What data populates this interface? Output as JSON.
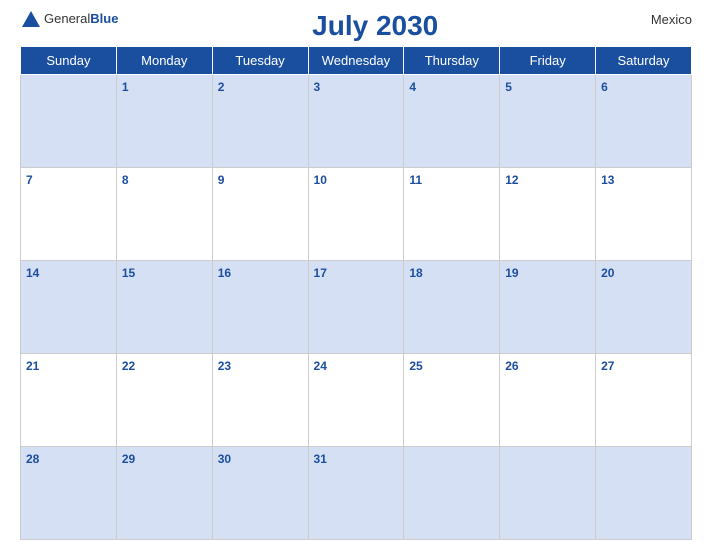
{
  "header": {
    "logo_general": "General",
    "logo_blue": "Blue",
    "title": "July 2030",
    "country": "Mexico"
  },
  "days_of_week": [
    "Sunday",
    "Monday",
    "Tuesday",
    "Wednesday",
    "Thursday",
    "Friday",
    "Saturday"
  ],
  "weeks": [
    [
      null,
      1,
      2,
      3,
      4,
      5,
      6
    ],
    [
      7,
      8,
      9,
      10,
      11,
      12,
      13
    ],
    [
      14,
      15,
      16,
      17,
      18,
      19,
      20
    ],
    [
      21,
      22,
      23,
      24,
      25,
      26,
      27
    ],
    [
      28,
      29,
      30,
      31,
      null,
      null,
      null
    ]
  ]
}
